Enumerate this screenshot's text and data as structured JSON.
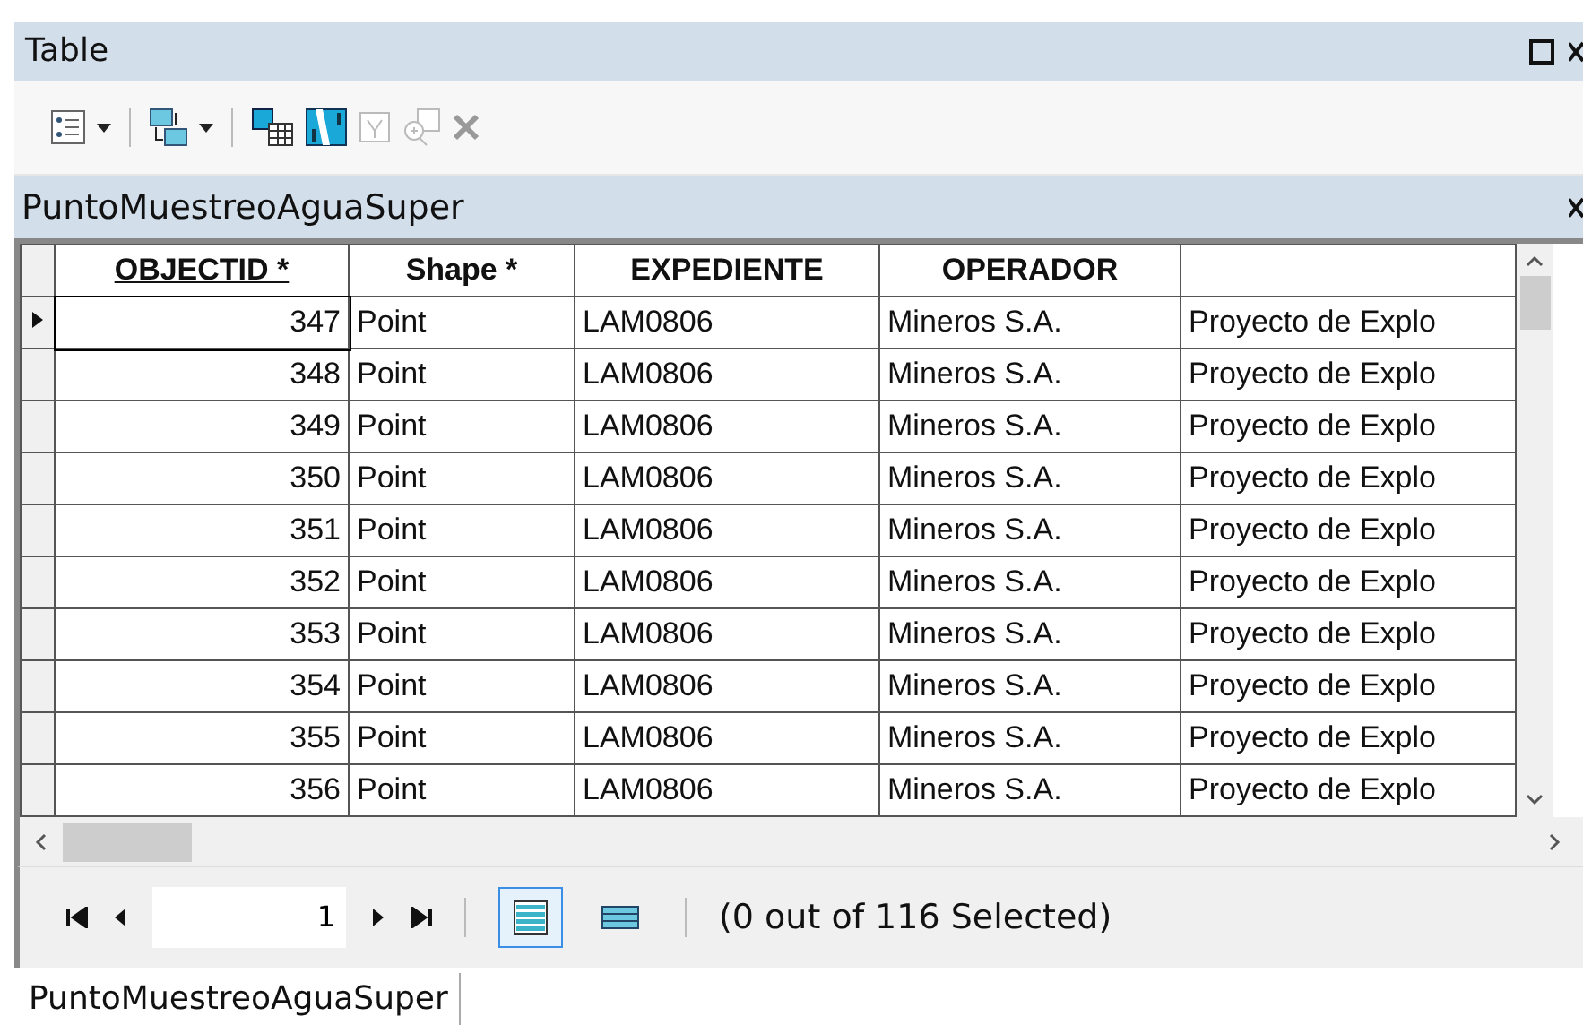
{
  "window": {
    "title": "Table"
  },
  "table_tab": {
    "title": "PuntoMuestreoAguaSuper"
  },
  "table": {
    "columns": [
      {
        "label": "OBJECTID *",
        "sorted": true
      },
      {
        "label": "Shape *",
        "sorted": false
      },
      {
        "label": "EXPEDIENTE",
        "sorted": false
      },
      {
        "label": "OPERADOR",
        "sorted": false
      },
      {}
    ],
    "rows": [
      {
        "current": true,
        "cells": [
          "347",
          "Point",
          "LAM0806",
          "Mineros S.A.",
          "Proyecto de Explo"
        ]
      },
      {
        "current": false,
        "cells": [
          "348",
          "Point",
          "LAM0806",
          "Mineros S.A.",
          "Proyecto de Explo"
        ]
      },
      {
        "current": false,
        "cells": [
          "349",
          "Point",
          "LAM0806",
          "Mineros S.A.",
          "Proyecto de Explo"
        ]
      },
      {
        "current": false,
        "cells": [
          "350",
          "Point",
          "LAM0806",
          "Mineros S.A.",
          "Proyecto de Explo"
        ]
      },
      {
        "current": false,
        "cells": [
          "351",
          "Point",
          "LAM0806",
          "Mineros S.A.",
          "Proyecto de Explo"
        ]
      },
      {
        "current": false,
        "cells": [
          "352",
          "Point",
          "LAM0806",
          "Mineros S.A.",
          "Proyecto de Explo"
        ]
      },
      {
        "current": false,
        "cells": [
          "353",
          "Point",
          "LAM0806",
          "Mineros S.A.",
          "Proyecto de Explo"
        ]
      },
      {
        "current": false,
        "cells": [
          "354",
          "Point",
          "LAM0806",
          "Mineros S.A.",
          "Proyecto de Explo"
        ]
      },
      {
        "current": false,
        "cells": [
          "355",
          "Point",
          "LAM0806",
          "Mineros S.A.",
          "Proyecto de Explo"
        ]
      },
      {
        "current": false,
        "cells": [
          "356",
          "Point",
          "LAM0806",
          "Mineros S.A.",
          "Proyecto de Explo"
        ]
      }
    ]
  },
  "navigation": {
    "record": "1",
    "view_all_selected": true,
    "status": "(0 out of 116 Selected)"
  },
  "bottom_tabs": [
    {
      "label": "PuntoMuestreoAguaSuper",
      "selected": true
    }
  ]
}
